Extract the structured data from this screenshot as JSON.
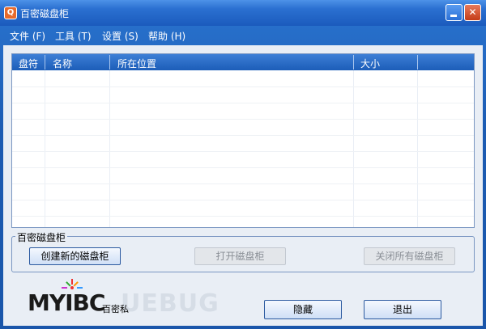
{
  "window": {
    "title": "百密磁盘柜",
    "icon_label": "Q"
  },
  "menu": [
    {
      "label": "文件 (F)"
    },
    {
      "label": "工具 (T)"
    },
    {
      "label": "设置 (S)"
    },
    {
      "label": "帮助 (H)"
    }
  ],
  "table": {
    "columns": [
      "盘符",
      "名称",
      "所在位置",
      "大小"
    ],
    "rows": []
  },
  "group": {
    "label": "百密磁盘柜",
    "create_button": "创建新的磁盘柜",
    "open_button": "打开磁盘柜",
    "close_all_button": "关闭所有磁盘柜"
  },
  "footer": {
    "logo_text": "MYIBC",
    "logo_sub": "百密私",
    "watermark": "UEBUG",
    "hide_button": "隐藏",
    "exit_button": "退出"
  },
  "colors": {
    "title_bar": "#2a6fd0",
    "accent": "#1c5db8",
    "client_bg": "#e9eef5",
    "close_button": "#c43c18"
  }
}
